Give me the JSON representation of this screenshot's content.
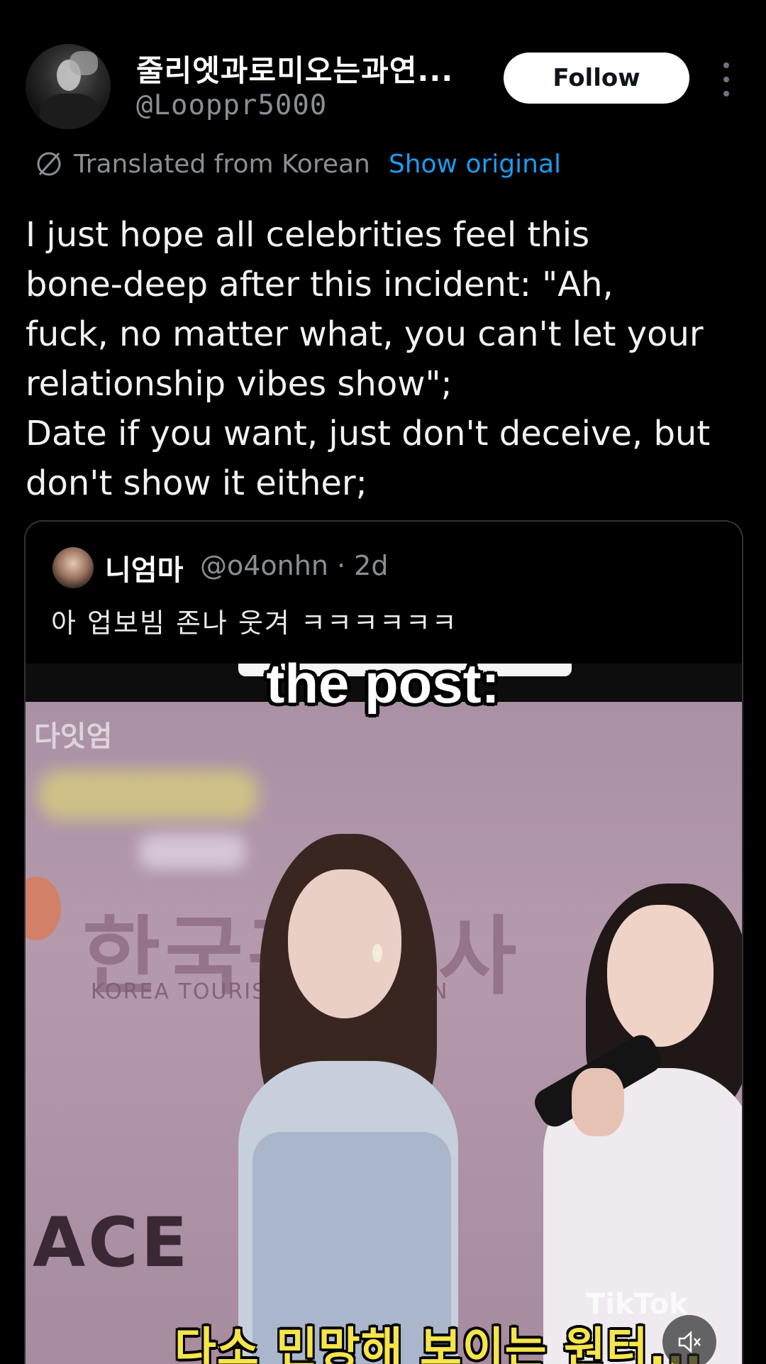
{
  "author": {
    "display_name": "줄리엣과로미오는과연...",
    "handle": "@Looppr5000"
  },
  "follow_label": "Follow",
  "translation": {
    "notice": "Translated from Korean",
    "show_original_label": "Show original"
  },
  "tweet_text": "I just hope all celebrities feel this\nbone-deep after this incident: \"Ah,\nfuck, no matter what, you can't let your\nrelationship vibes show\";\nDate if you want, just don't deceive, but\ndon't show it either;",
  "quoted": {
    "display_name": "니엄마",
    "handle_time": "@o4onhn · 2d",
    "text": "아 업보빔 존나 웃겨 ㅋㅋㅋㅋㅋㅋ"
  },
  "media": {
    "watermark": "다잇엄",
    "sign_korean_left": "한국관",
    "sign_korean_right": "사",
    "sign_english_left": "KOREA TOURISM",
    "sign_english_right": "N",
    "sign_ace": "ACE",
    "tiktok_label": "TikTok",
    "subtitle": "다소 민망해 보이는 원터..."
  },
  "caption": "the post:",
  "icons": {
    "translate": "translate-icon",
    "more": "more-icon",
    "mute": "mute-icon"
  },
  "colors": {
    "background": "#000000",
    "link_blue": "#1d9bf0",
    "subtitle_yellow": "#f6e54a"
  }
}
